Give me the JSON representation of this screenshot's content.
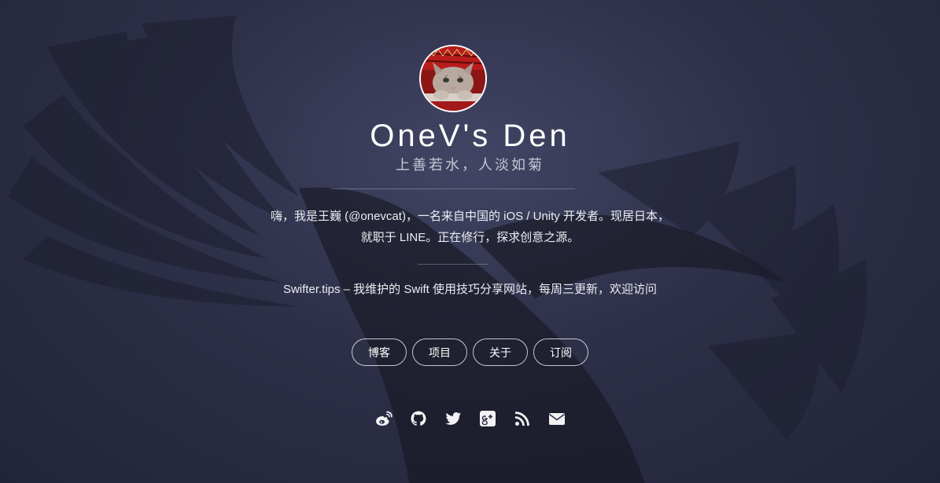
{
  "site": {
    "title": "OneV's Den",
    "subtitle": "上善若水，人淡如菊"
  },
  "bio": {
    "line1": "嗨，我是王巍 (@onevcat)，一名来自中国的 iOS / Unity 开发者。现居日本，",
    "line2": "就职于 LINE。正在修行，探求创意之源。"
  },
  "promo": {
    "text": "Swifter.tips – 我维护的 Swift 使用技巧分享网站，每周三更新，欢迎访问"
  },
  "nav": {
    "items": [
      {
        "label": "博客"
      },
      {
        "label": "项目"
      },
      {
        "label": "关于"
      },
      {
        "label": "订阅"
      }
    ]
  },
  "social": {
    "icons": [
      "weibo-icon",
      "github-icon",
      "twitter-icon",
      "google-plus-icon",
      "rss-icon",
      "email-icon"
    ]
  },
  "colors": {
    "background": "#2e3049",
    "text": "#ffffff",
    "subtitle": "#c5c7d4"
  }
}
